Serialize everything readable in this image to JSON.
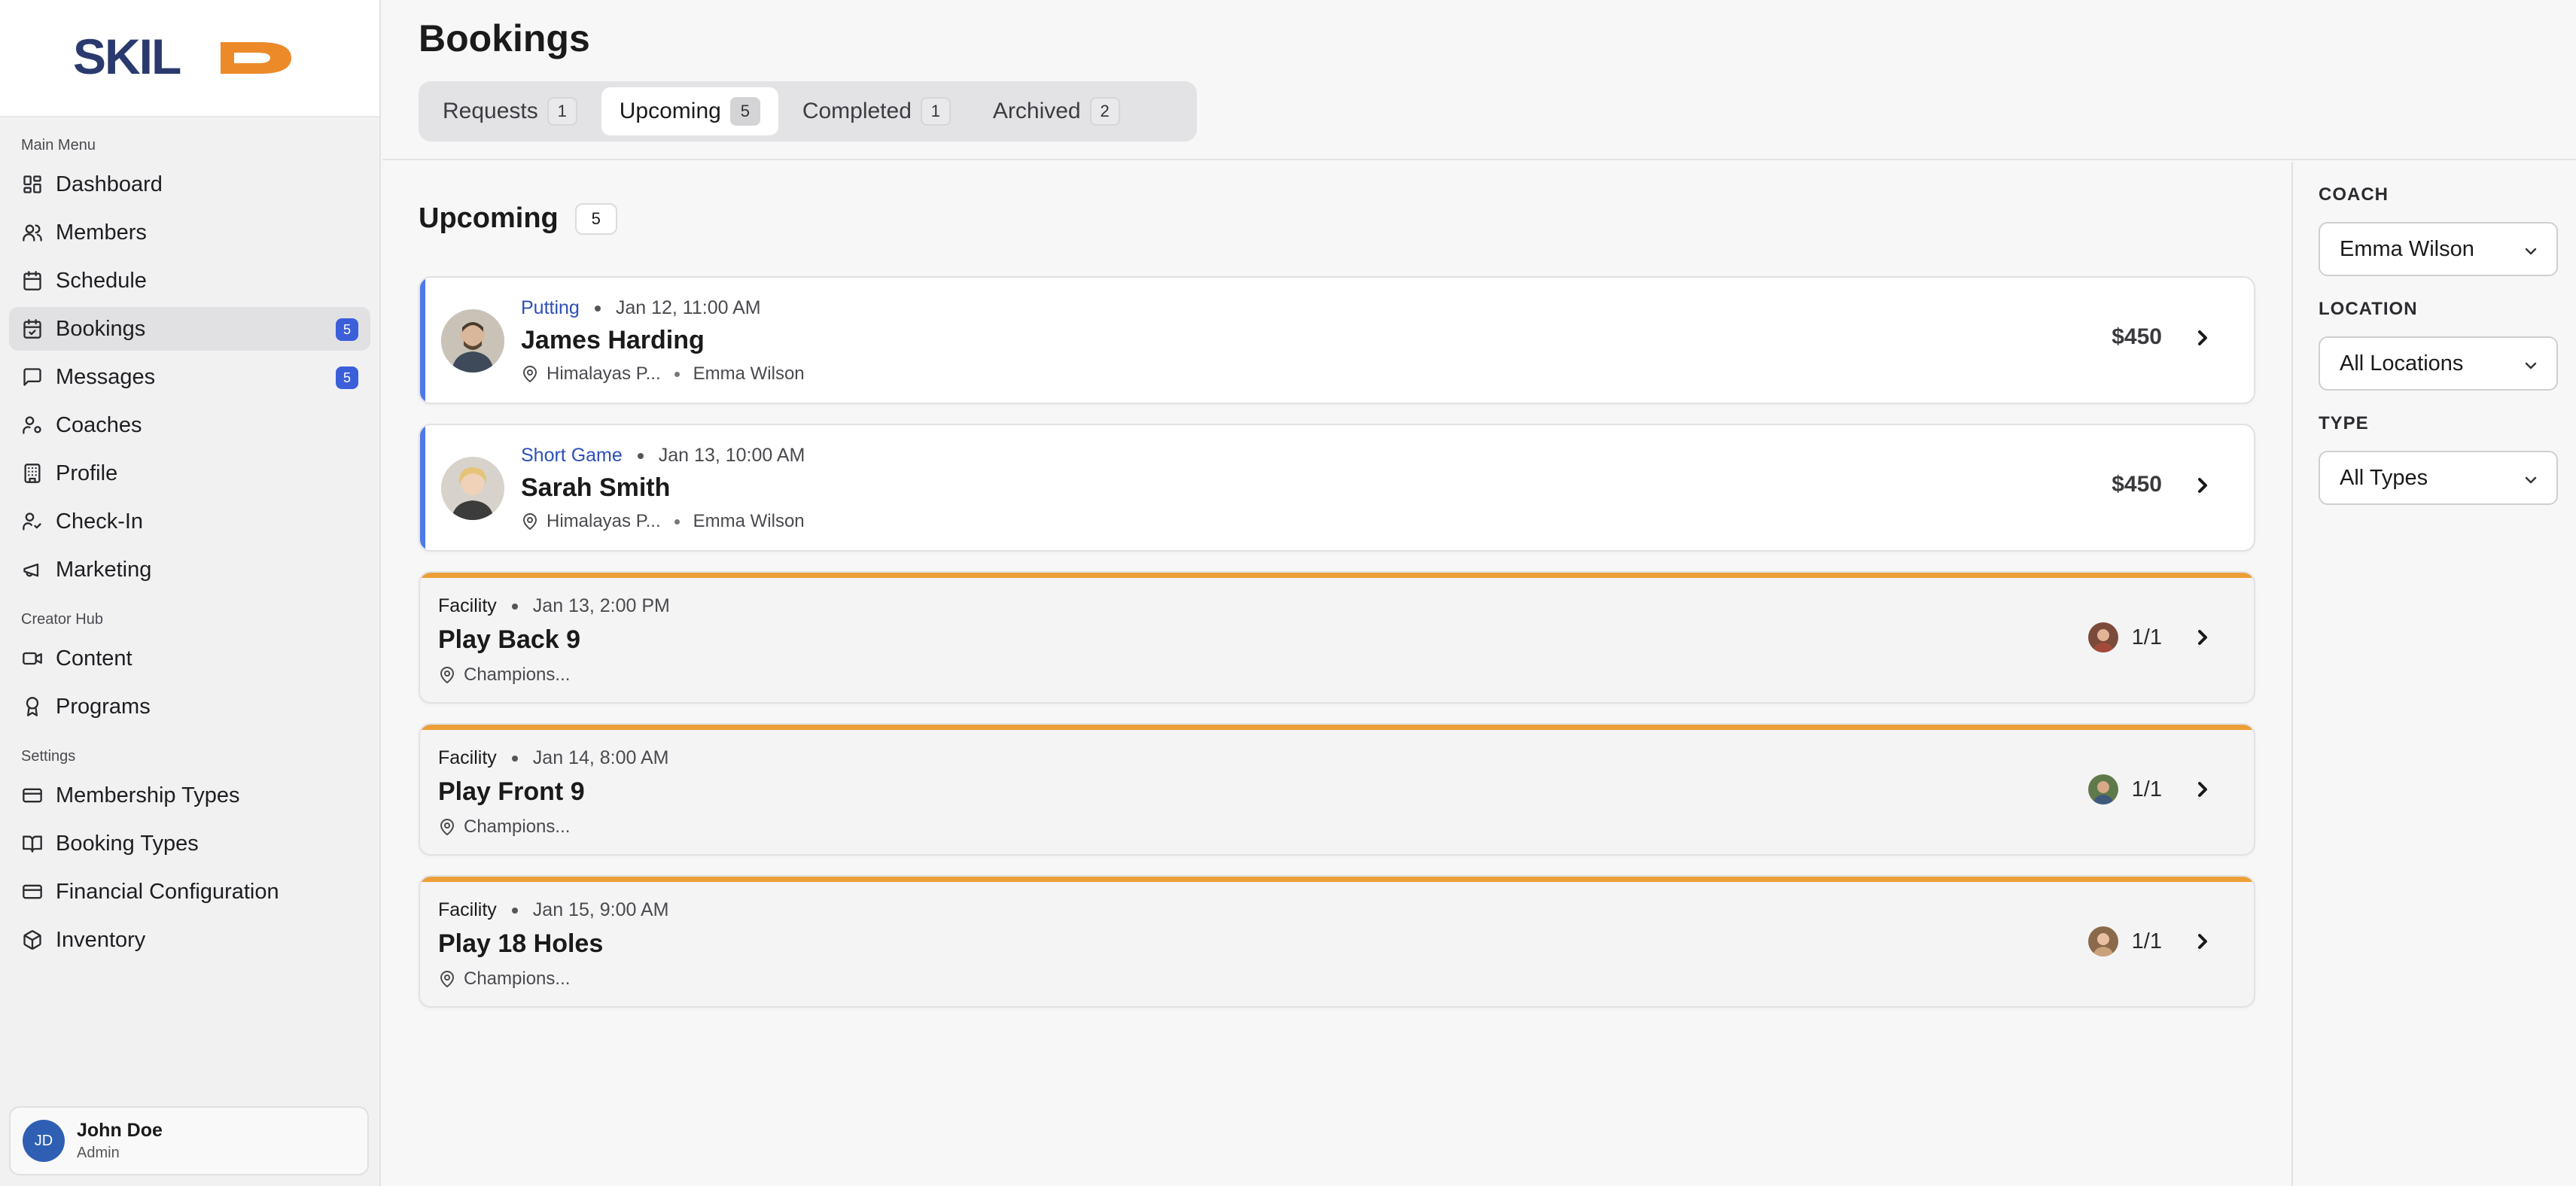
{
  "app": {
    "logo_text": "SKILD"
  },
  "sidebar": {
    "sections": [
      {
        "title": "Main Menu"
      },
      {
        "title": "Creator Hub"
      },
      {
        "title": "Settings"
      }
    ],
    "items": [
      {
        "label": "Dashboard",
        "icon": "dashboard-icon"
      },
      {
        "label": "Members",
        "icon": "users-icon"
      },
      {
        "label": "Schedule",
        "icon": "calendar-icon"
      },
      {
        "label": "Bookings",
        "icon": "calendar-check-icon",
        "badge": "5",
        "active": true
      },
      {
        "label": "Messages",
        "icon": "message-icon",
        "badge": "5"
      },
      {
        "label": "Coaches",
        "icon": "user-cog-icon"
      },
      {
        "label": "Profile",
        "icon": "building-icon"
      },
      {
        "label": "Check-In",
        "icon": "user-check-icon"
      },
      {
        "label": "Marketing",
        "icon": "megaphone-icon"
      },
      {
        "label": "Content",
        "icon": "video-icon"
      },
      {
        "label": "Programs",
        "icon": "award-icon"
      },
      {
        "label": "Membership Types",
        "icon": "credit-card-icon"
      },
      {
        "label": "Booking Types",
        "icon": "book-open-icon"
      },
      {
        "label": "Financial Configuration",
        "icon": "credit-card-icon"
      },
      {
        "label": "Inventory",
        "icon": "package-icon"
      }
    ],
    "user": {
      "initials": "JD",
      "name": "John Doe",
      "role": "Admin"
    }
  },
  "header": {
    "title": "Bookings",
    "tabs": [
      {
        "label": "Requests",
        "count": "1"
      },
      {
        "label": "Upcoming",
        "count": "5",
        "active": true
      },
      {
        "label": "Completed",
        "count": "1"
      },
      {
        "label": "Archived",
        "count": "2"
      }
    ]
  },
  "main": {
    "section_title": "Upcoming",
    "section_count": "5",
    "bookings": [
      {
        "kind": "lesson",
        "type": "Putting",
        "date": "Jan 12, 11:00 AM",
        "name": "James Harding",
        "location": "Himalayas P...",
        "coach": "Emma Wilson",
        "price": "$450"
      },
      {
        "kind": "lesson",
        "type": "Short Game",
        "date": "Jan 13, 10:00 AM",
        "name": "Sarah Smith",
        "location": "Himalayas P...",
        "coach": "Emma Wilson",
        "price": "$450"
      },
      {
        "kind": "facility",
        "type": "Facility",
        "date": "Jan 13, 2:00 PM",
        "name": "Play Back 9",
        "location": "Champions...",
        "attendance": "1/1"
      },
      {
        "kind": "facility",
        "type": "Facility",
        "date": "Jan 14, 8:00 AM",
        "name": "Play Front 9",
        "location": "Champions...",
        "attendance": "1/1"
      },
      {
        "kind": "facility",
        "type": "Facility",
        "date": "Jan 15, 9:00 AM",
        "name": "Play 18 Holes",
        "location": "Champions...",
        "attendance": "1/1"
      }
    ]
  },
  "filters": {
    "coach": {
      "label": "COACH",
      "value": "Emma Wilson"
    },
    "location": {
      "label": "LOCATION",
      "value": "All Locations"
    },
    "type": {
      "label": "TYPE",
      "value": "All Types"
    }
  },
  "colors": {
    "accent_blue": "#3b5fd9",
    "lesson_border": "#4d79e8",
    "facility_border": "#ec9f36",
    "logo_navy": "#2a3a6e",
    "logo_orange": "#ec8a2a"
  }
}
